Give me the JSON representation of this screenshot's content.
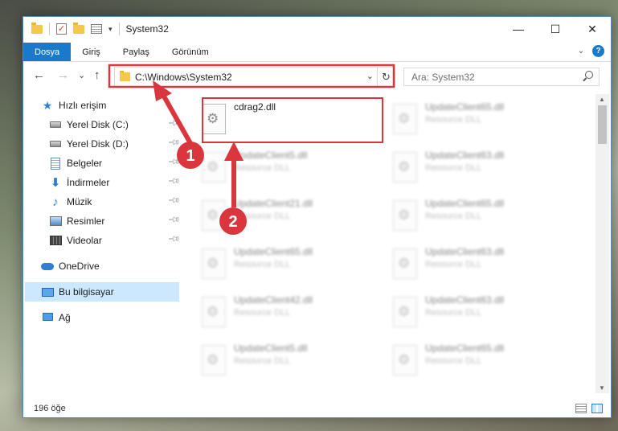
{
  "window": {
    "title": "System32",
    "controls": {
      "minimize": "—",
      "maximize": "☐",
      "close": "✕"
    }
  },
  "ribbon": {
    "tabs": [
      "Dosya",
      "Giriş",
      "Paylaş",
      "Görünüm"
    ],
    "help": "?"
  },
  "navigation": {
    "back": "←",
    "forward": "→",
    "recent": "⌄",
    "up": "↑",
    "address": "C:\\Windows\\System32",
    "refresh": "↻",
    "search_placeholder": "Ara: System32"
  },
  "sidebar": {
    "quick_access": "Hızlı erişim",
    "items": [
      {
        "label": "Yerel Disk (C:)",
        "icon": "drive-icon",
        "pinned": true
      },
      {
        "label": "Yerel Disk (D:)",
        "icon": "drive-icon",
        "pinned": true
      },
      {
        "label": "Belgeler",
        "icon": "documents-icon",
        "pinned": true
      },
      {
        "label": "İndirmeler",
        "icon": "downloads-icon",
        "pinned": true
      },
      {
        "label": "Müzik",
        "icon": "music-icon",
        "pinned": true
      },
      {
        "label": "Resimler",
        "icon": "pictures-icon",
        "pinned": true
      },
      {
        "label": "Videolar",
        "icon": "videos-icon",
        "pinned": true
      }
    ],
    "onedrive": "OneDrive",
    "this_pc": "Bu bilgisayar",
    "network": "Ağ"
  },
  "files": {
    "highlighted": {
      "name": "cdrag2.dll",
      "type": ""
    },
    "left_column": [
      {
        "name": "UpdateClient5.dll",
        "type": "Resource DLL"
      },
      {
        "name": "UpdateClient21.dll",
        "type": "Resource DLL"
      },
      {
        "name": "UpdateClient65.dll",
        "type": "Resource DLL"
      },
      {
        "name": "UpdateClient42.dll",
        "type": "Resource DLL"
      },
      {
        "name": "UpdateClient5.dll",
        "type": "Resource DLL"
      }
    ],
    "right_column": [
      {
        "name": "UpdateClient65.dll",
        "type": "Resource DLL"
      },
      {
        "name": "UpdateClient63.dll",
        "type": "Resource DLL"
      },
      {
        "name": "UpdateClient65.dll",
        "type": "Resource DLL"
      },
      {
        "name": "UpdateClient63.dll",
        "type": "Resource DLL"
      },
      {
        "name": "UpdateClient63.dll",
        "type": "Resource DLL"
      },
      {
        "name": "UpdateClient65.dll",
        "type": "Resource DLL"
      }
    ]
  },
  "status": {
    "count": "196 öğe"
  },
  "annotations": {
    "step1": "1",
    "step2": "2",
    "color": "#d9363e"
  }
}
